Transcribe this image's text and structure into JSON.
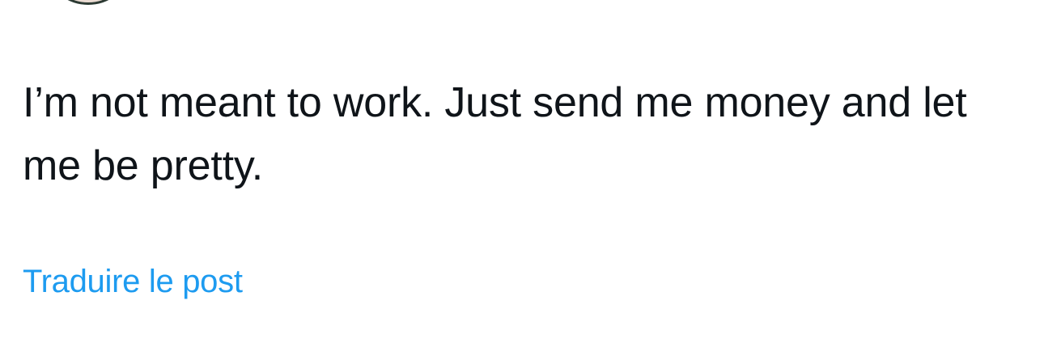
{
  "post": {
    "text": "I’m not meant to work. Just send me money and let me be pretty.",
    "translate_label": "Traduire le post"
  },
  "colors": {
    "text": "#0f1419",
    "link": "#1d9bf0",
    "background": "#ffffff"
  }
}
